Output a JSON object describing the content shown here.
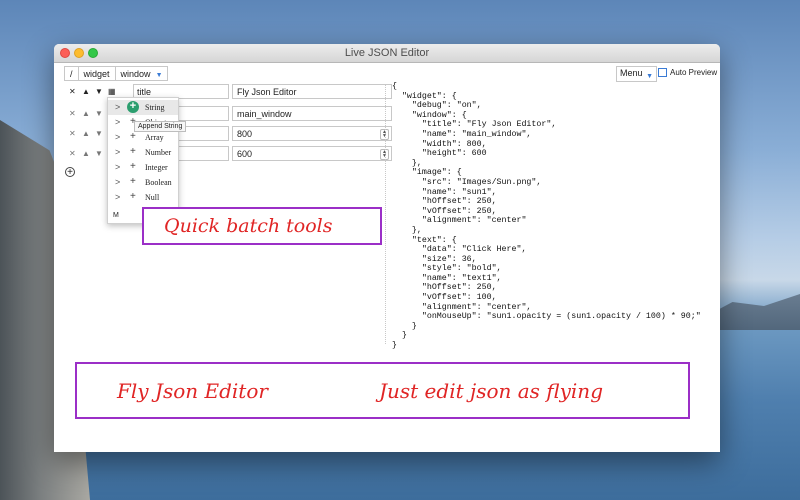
{
  "window": {
    "title": "Live JSON Editor"
  },
  "toolbar": {
    "breadcrumbs": [
      "/",
      "widget",
      "window"
    ],
    "menu_label": "Menu",
    "auto_preview_label": "Auto Preview"
  },
  "rows": [
    {
      "key": "title",
      "value": "Fly Json Editor"
    },
    {
      "key": "",
      "value": "main_window"
    },
    {
      "key": "",
      "value": "800"
    },
    {
      "key": "",
      "value": "600"
    }
  ],
  "popup": {
    "items": [
      "String",
      "Object",
      "Array",
      "Number",
      "Integer",
      "Boolean",
      "Null"
    ],
    "selected": "String",
    "tooltip": "Append String",
    "footer": "M"
  },
  "json_text": "{\n  \"widget\": {\n    \"debug\": \"on\",\n    \"window\": {\n      \"title\": \"Fly Json Editor\",\n      \"name\": \"main_window\",\n      \"width\": 800,\n      \"height\": 600\n    },\n    \"image\": {\n      \"src\": \"Images/Sun.png\",\n      \"name\": \"sun1\",\n      \"hOffset\": 250,\n      \"vOffset\": 250,\n      \"alignment\": \"center\"\n    },\n    \"text\": {\n      \"data\": \"Click Here\",\n      \"size\": 36,\n      \"style\": \"bold\",\n      \"name\": \"text1\",\n      \"hOffset\": 250,\n      \"vOffset\": 100,\n      \"alignment\": \"center\",\n      \"onMouseUp\": \"sun1.opacity = (sun1.opacity / 100) * 90;\"\n    }\n  }\n}",
  "callouts": {
    "quick": "Quick batch tools",
    "left": "Fly Json Editor",
    "right": "Just edit json as flying"
  },
  "colors": {
    "callout_border": "#9b2fc7",
    "callout_text": "#e02525",
    "accent": "#3a7bd5"
  }
}
